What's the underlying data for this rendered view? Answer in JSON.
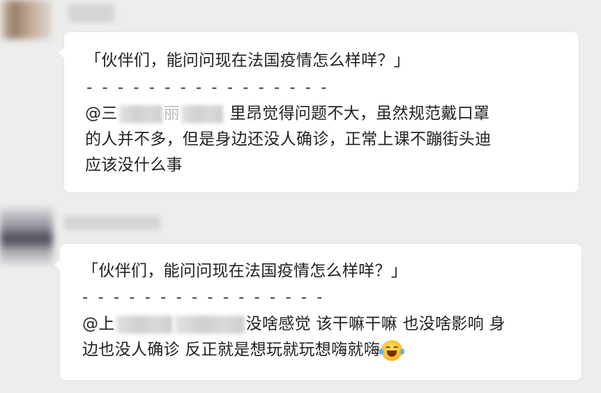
{
  "messages": [
    {
      "quote": "「伙伴们，能问问现在法国疫情怎么样咩？」",
      "divider": "- - - - - - - - - - - - - - - -",
      "mention_prefix": "@三",
      "mention_mid": "丽",
      "reply_line1": "里昂觉得问题不大，虽然规范戴口罩",
      "reply_line2": "的人并不多，但是身边还没人确诊，正常上课不蹦街头迪",
      "reply_line3": "应该没什么事"
    },
    {
      "quote": "「伙伴们，能问问现在法国疫情怎么样咩？」",
      "divider": "- - - - - - - - - - - - - - - -",
      "mention_prefix": "@上",
      "reply_line1": "没啥感觉 该干嘛干嘛 也没啥影响 身",
      "reply_line2": "边也没人确诊 反正就是想玩就玩想嗨就嗨",
      "emoji_icon": "face-with-tears-of-joy-icon"
    }
  ]
}
